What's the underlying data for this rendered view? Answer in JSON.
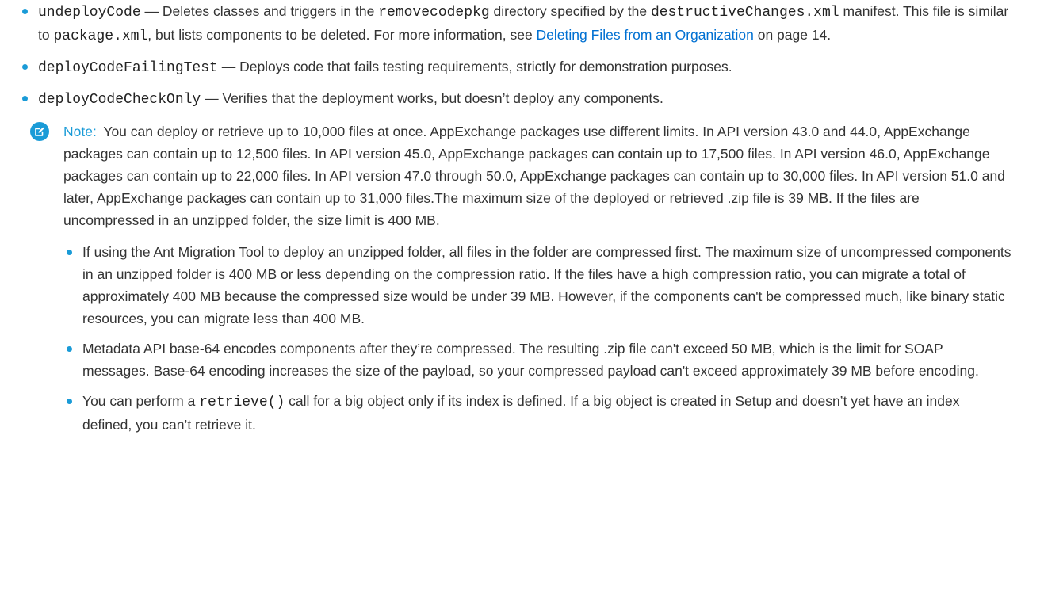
{
  "items": [
    {
      "code": "undeployCode",
      "t1": " — Deletes classes and triggers in the ",
      "code2": "removecodepkg",
      "t2": " directory specified by the ",
      "code3": "destructiveChanges.xml",
      "t3": " manifest. This file is similar to ",
      "code4": "package.xml",
      "t4": ", but lists components to be deleted. For more information, see ",
      "link": "Deleting Files from an Organization",
      "t5": " on page 14."
    },
    {
      "code": "deployCodeFailingTest",
      "t1": " — Deploys code that fails testing requirements, strictly for demonstration purposes."
    },
    {
      "code": "deployCodeCheckOnly",
      "t1": " — Verifies that the deployment works, but doesn’t deploy any components."
    }
  ],
  "note": {
    "label": "Note:",
    "text": "You can deploy or retrieve up to 10,000 files at once. AppExchange packages use different limits. In API version 43.0 and 44.0, AppExchange packages can contain up to 12,500 files. In API version 45.0, AppExchange packages can contain up to 17,500 files. In API version 46.0, AppExchange packages can contain up to 22,000 files. In API version 47.0 through 50.0, AppExchange packages can contain up to 30,000 files. In API version 51.0 and later, AppExchange packages can contain up to 31,000 files.The maximum size of the deployed or retrieved .zip file is 39 MB. If the files are uncompressed in an unzipped folder, the size limit is 400 MB.",
    "bullets": [
      {
        "text": "If using the Ant Migration Tool to deploy an unzipped folder, all files in the folder are compressed first. The maximum size of uncompressed components in an unzipped folder is 400 MB or less depending on the compression ratio. If the files have a high compression ratio, you can migrate a total of approximately 400 MB because the compressed size would be under 39 MB. However, if the components can't be compressed much, like binary static resources, you can migrate less than 400 MB."
      },
      {
        "text": "Metadata API base-64 encodes components after they’re compressed. The resulting .zip file can't exceed 50 MB, which is the limit for SOAP messages. Base-64 encoding increases the size of the payload, so your compressed payload can't exceed approximately 39 MB before encoding."
      },
      {
        "pre": "You can perform a ",
        "code": "retrieve()",
        "post": " call for a big object only if its index is defined. If a big object is created in Setup and doesn’t yet have an index defined, you can’t retrieve it."
      }
    ]
  },
  "colors": {
    "bullet": "#1a9bd7",
    "link": "#0070d2",
    "note_label": "#1a9bd7",
    "text": "#333333"
  },
  "icons": {
    "note": "edit-pencil-icon"
  }
}
